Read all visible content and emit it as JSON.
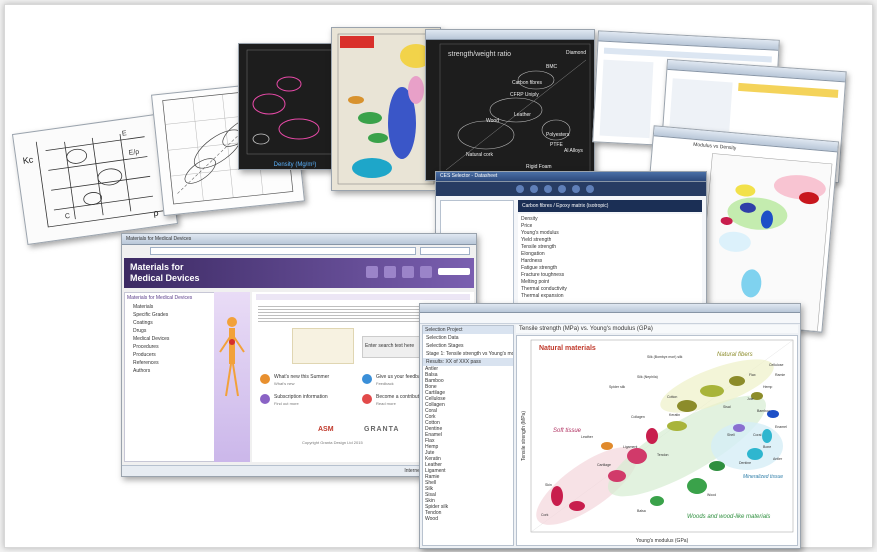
{
  "sketch": {
    "axis_label_y": "Kc",
    "axis_label_x": "ρ",
    "marks": [
      "E",
      "E/ρ",
      "C"
    ]
  },
  "chart_dark_1": {
    "xlabel": "Density (Mg/m³)"
  },
  "chart_dark_2": {
    "title": "strength/weight ratio",
    "labels": [
      "BMC",
      "Diamond",
      "Carbon fibres",
      "CFRP Uniply",
      "Leather",
      "Wood",
      "Polyesters",
      "PTFE",
      "Al Alloys",
      "Rigid Foam",
      "Natural cork"
    ]
  },
  "mfg_window": {
    "brand_line1": "Materials for",
    "brand_line2": "Medical Devices",
    "browser_title": "Materials for Medical Devices",
    "sidebar_tab": "Materials for Medical Devices",
    "tree": [
      "Materials",
      "Specific Grades",
      "Coatings",
      "Drugs",
      "Medical Devices",
      "Procedures",
      "Producers",
      "References",
      "Authors"
    ],
    "tiles": [
      {
        "title": "What's new this Summer",
        "sub": "What's new"
      },
      {
        "title": "Give us your feedback",
        "sub": "Feedback"
      },
      {
        "title": "Subscription information",
        "sub": "Find out more"
      },
      {
        "title": "Become a contributor",
        "sub": "Read more"
      }
    ],
    "search_button": "Enter search text here",
    "footer_left": "Copyright Granta Design Ltd 2015",
    "logo_partner": "ASM",
    "logo_granta": "GRANTA",
    "statusbar": "Internet | Protected Mode: Off"
  },
  "ces_window": {
    "chart_title": "Tensile strength (MPa) vs. Young's modulus (GPa)",
    "xlabel": "Young's modulus (GPa)",
    "ylabel": "Tensile strength (MPa)",
    "annotations": [
      "Natural materials",
      "Natural fibers",
      "Soft tissue",
      "Mineralized tissue",
      "Woods and wood-like materials"
    ],
    "bubble_labels": [
      "Silk (Bombyx mori) silk",
      "Silk (Nephila)",
      "Spider silk",
      "Cotton",
      "Flax",
      "Hemp",
      "Ramie",
      "Sisal",
      "Jute",
      "Cellulose",
      "Bamboo",
      "Wood",
      "Bone",
      "Cork",
      "Skin",
      "Tendon",
      "Cartilage",
      "Ligament",
      "Collagen",
      "Keratin",
      "Leather",
      "Enamel",
      "Dentine",
      "Antler",
      "Shell",
      "Coral",
      "Balsa"
    ],
    "tree_header": "Selection Project",
    "selection_items": [
      "Selection Data",
      "Selection Stages",
      "Stage 1: Tensile strength vs Young's modulus",
      "Results: XX of XXX pass"
    ],
    "results": [
      "Antler",
      "Balsa",
      "Bamboo",
      "Bone",
      "Cartilage",
      "Cellulose",
      "Collagen",
      "Coral",
      "Cork",
      "Cotton",
      "Dentine",
      "Enamel",
      "Flax",
      "Hemp",
      "Jute",
      "Keratin",
      "Leather",
      "Ligament",
      "Ramie",
      "Shell",
      "Silk",
      "Sisal",
      "Skin",
      "Spider silk",
      "Tendon",
      "Wood"
    ]
  },
  "datasheet_window": {
    "title": "CES Selector - Datasheet",
    "header": "Carbon fibres / Epoxy matrix (isotropic)",
    "fields": [
      "Density",
      "Price",
      "Young's modulus",
      "Yield strength",
      "Tensile strength",
      "Elongation",
      "Hardness",
      "Fatigue strength",
      "Fracture toughness",
      "Melting point",
      "Thermal conductivity",
      "Thermal expansion"
    ]
  },
  "bubble_window": {
    "title": "Modulus vs Density"
  },
  "colors": {
    "accent_purple": "#5a3d8a",
    "ces_blue": "#2f4f8f",
    "natural_red": "#c0392b",
    "fiber_olive": "#8c8c2a"
  }
}
